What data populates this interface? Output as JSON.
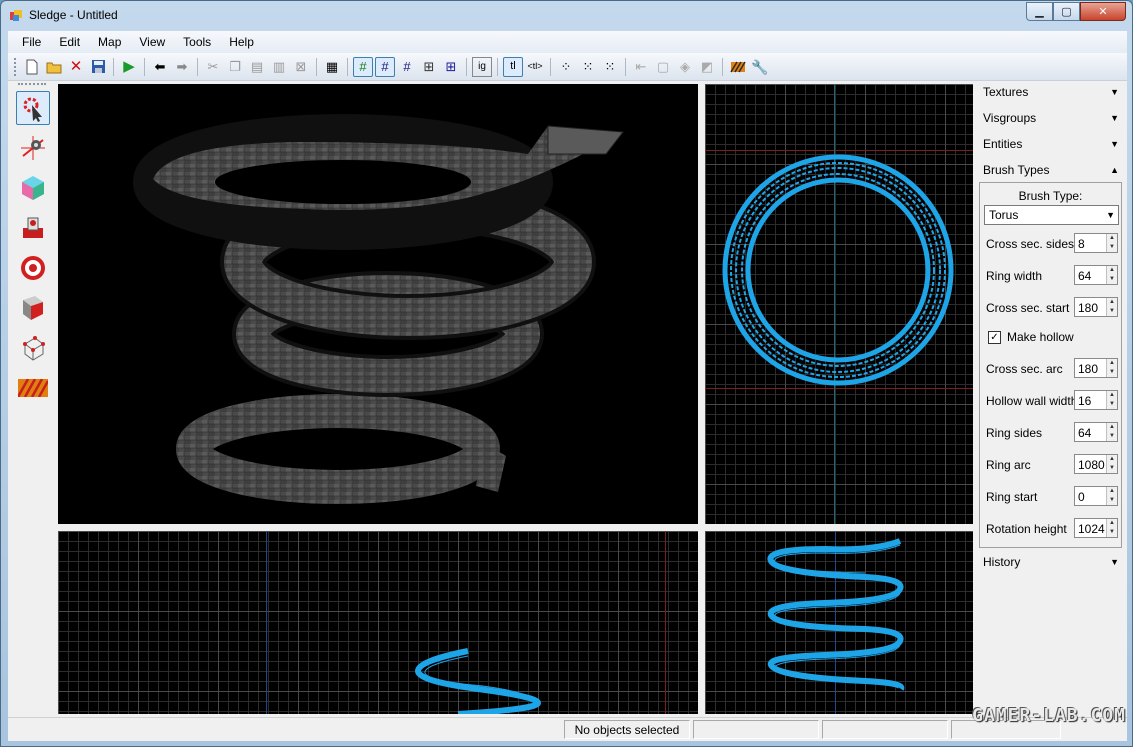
{
  "window": {
    "title": "Sledge - Untitled",
    "minimize": "▁",
    "maximize": "▢",
    "close": "✕"
  },
  "menu": [
    "File",
    "Edit",
    "Map",
    "View",
    "Tools",
    "Help"
  ],
  "side_panel": {
    "sections": {
      "textures": "Textures",
      "visgroups": "Visgroups",
      "entities": "Entities",
      "brush_types": "Brush Types",
      "history": "History"
    },
    "brush_type_label": "Brush Type:",
    "brush_type_value": "Torus",
    "fields": [
      {
        "label": "Cross sec. sides",
        "value": "8"
      },
      {
        "label": "Ring width",
        "value": "64"
      },
      {
        "label": "Cross sec. start",
        "value": "180"
      },
      {
        "label": "Cross sec. arc",
        "value": "180"
      },
      {
        "label": "Hollow wall width",
        "value": "16"
      },
      {
        "label": "Ring sides",
        "value": "64"
      },
      {
        "label": "Ring arc",
        "value": "1080"
      },
      {
        "label": "Ring start",
        "value": "0"
      },
      {
        "label": "Rotation height",
        "value": "1024"
      }
    ],
    "make_hollow": {
      "label": "Make hollow",
      "checked": true
    }
  },
  "status": {
    "selection": "No objects selected"
  },
  "watermark": "GAMER-LAB.COM",
  "colors": {
    "wireframe": "#1ea5e8",
    "axis_red": "#7a1e1e",
    "axis_green": "#1e6a3a",
    "viewport_bg": "#000000"
  }
}
